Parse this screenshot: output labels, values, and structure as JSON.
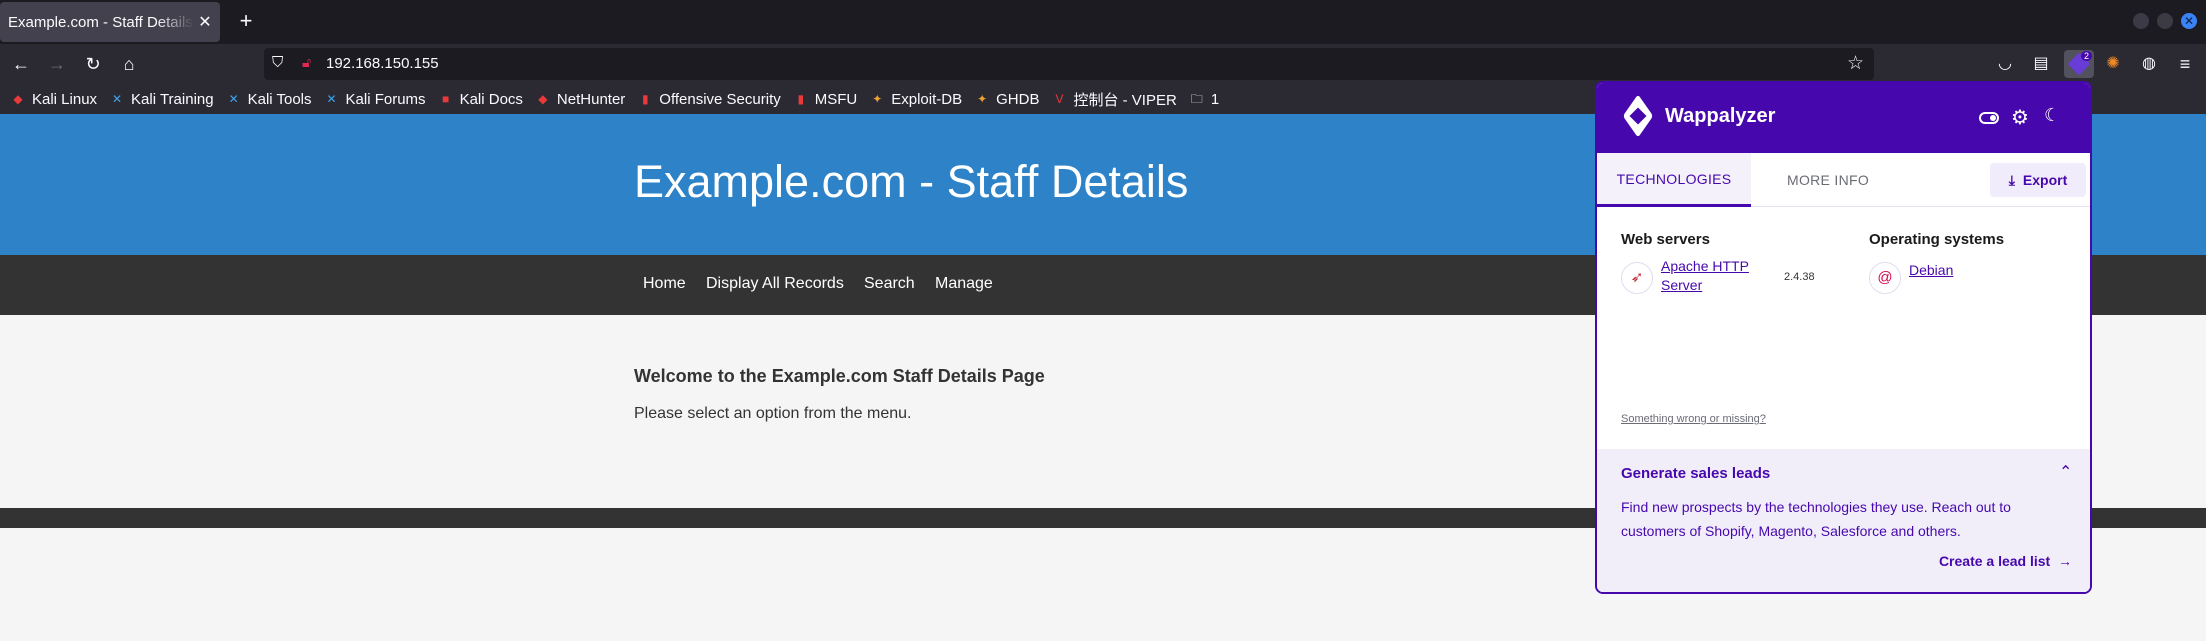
{
  "browser": {
    "tab_title": "Example.com - Staff Details",
    "tab_close": "✕",
    "new_tab": "+",
    "url": "192.168.150.155",
    "bookmarks": [
      {
        "label": "Kali Linux",
        "icon": "kali-dragon-icon",
        "color": "#e83a3a"
      },
      {
        "label": "Kali Training",
        "icon": "kali-training-icon",
        "color": "#3fa3e8"
      },
      {
        "label": "Kali Tools",
        "icon": "kali-tools-icon",
        "color": "#3fa3e8"
      },
      {
        "label": "Kali Forums",
        "icon": "kali-forums-icon",
        "color": "#3fa3e8"
      },
      {
        "label": "Kali Docs",
        "icon": "kali-docs-icon",
        "color": "#e83a3a"
      },
      {
        "label": "NetHunter",
        "icon": "nethunter-icon",
        "color": "#e83a3a"
      },
      {
        "label": "Offensive Security",
        "icon": "offsec-icon",
        "color": "#e83a3a"
      },
      {
        "label": "MSFU",
        "icon": "msfu-icon",
        "color": "#e83a3a"
      },
      {
        "label": "Exploit-DB",
        "icon": "exploitdb-icon",
        "color": "#f0a030"
      },
      {
        "label": "GHDB",
        "icon": "ghdb-icon",
        "color": "#f0a030"
      },
      {
        "label": "控制台 - VIPER",
        "icon": "viper-icon",
        "color": "#e83a3a"
      },
      {
        "label": "1",
        "icon": "folder-icon",
        "color": "#fbfbfe"
      }
    ]
  },
  "page": {
    "header_title": "Example.com - Staff Details",
    "menu": [
      "Home",
      "Display All Records",
      "Search",
      "Manage"
    ],
    "welcome_heading": "Welcome to the Example.com Staff Details Page",
    "intro_text": "Please select an option from the menu."
  },
  "wappalyzer": {
    "brand": "Wappalyzer",
    "ext_badge": "2",
    "tabs": {
      "technologies": "TECHNOLOGIES",
      "more_info": "MORE INFO"
    },
    "export_label": "Export",
    "categories": [
      {
        "name": "Web servers",
        "tech_line1": "Apache HTTP",
        "tech_line2": "Server",
        "version": "2.4.38"
      },
      {
        "name": "Operating systems",
        "tech_line1": "Debian",
        "tech_line2": "",
        "version": ""
      }
    ],
    "missing_link": "Something wrong or missing?",
    "leads": {
      "title": "Generate sales leads",
      "text": "Find new prospects by the technologies they use. Reach out to customers of Shopify, Magento, Salesforce and others.",
      "cta": "Create a lead list"
    },
    "colors": {
      "brand": "#4608ad"
    }
  }
}
